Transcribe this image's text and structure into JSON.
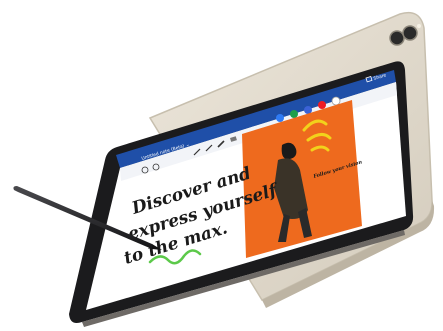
{
  "scene": {
    "subject": "tablet-with-stylus",
    "colors": {
      "back_device": "#e3dccf",
      "bezel": "#1b1b1d",
      "toolbar": "#1f4fa8",
      "canvas": "#ffffff",
      "photo_bg": "#ee6a1e",
      "accent_yellow": "#f2d21b",
      "accent_green": "#5cc94a",
      "ink": "#1a1a1a",
      "pen_body": "#2a2a2c"
    }
  },
  "toolbar": {
    "document_title": "Untitled note (Beta) ⌄",
    "share_label": "Share",
    "pen_colors": [
      "#2f7bf5",
      "#1f9e4a",
      "#3b62d6",
      "#ee1c25",
      "#ffffff"
    ],
    "tool_icons": [
      "undo-icon",
      "redo-icon",
      "pen-icon",
      "pencil-icon",
      "highlighter-icon",
      "eraser-icon",
      "lasso-icon"
    ]
  },
  "note": {
    "headline_lines": [
      "Discover and",
      "express yourself",
      "to the max."
    ],
    "caption": "Follow your vision"
  }
}
